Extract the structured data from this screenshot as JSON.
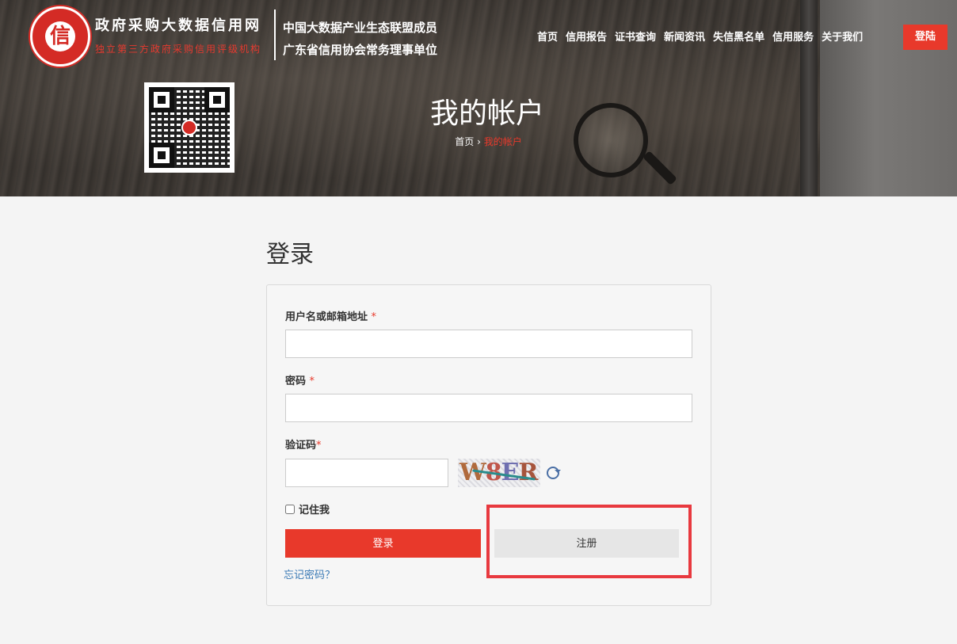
{
  "brand": {
    "logo_char": "信",
    "site_name": "政府采购大数据信用网",
    "slogan": "独立第三方政府采购信用评级机构",
    "member_line_1": "中国大数据产业生态联盟成员",
    "member_line_2": "广东省信用协会常务理事单位"
  },
  "nav": {
    "items": [
      "首页",
      "信用报告",
      "证书查询",
      "新闻资讯",
      "失信黑名单",
      "信用服务",
      "关于我们"
    ],
    "login_label": "登陆"
  },
  "hero": {
    "title": "我的帐户",
    "breadcrumb_home": "首页",
    "breadcrumb_separator": "›",
    "breadcrumb_current": "我的帐户"
  },
  "login": {
    "heading": "登录",
    "username_label": "用户名或邮箱地址",
    "password_label": "密码",
    "captcha_label": "验证码",
    "required_mark": "*",
    "captcha_chars": [
      "W",
      "8",
      "E",
      "R"
    ],
    "remember_label": "记住我",
    "submit_label": "登录",
    "register_label": "注册",
    "forgot_label": "忘记密码？"
  },
  "colors": {
    "accent": "#e8392b",
    "link": "#3b7ab5",
    "highlight": "#e8393f"
  },
  "icons": {
    "refresh": "refresh-icon",
    "qr": "qr-code-icon"
  }
}
